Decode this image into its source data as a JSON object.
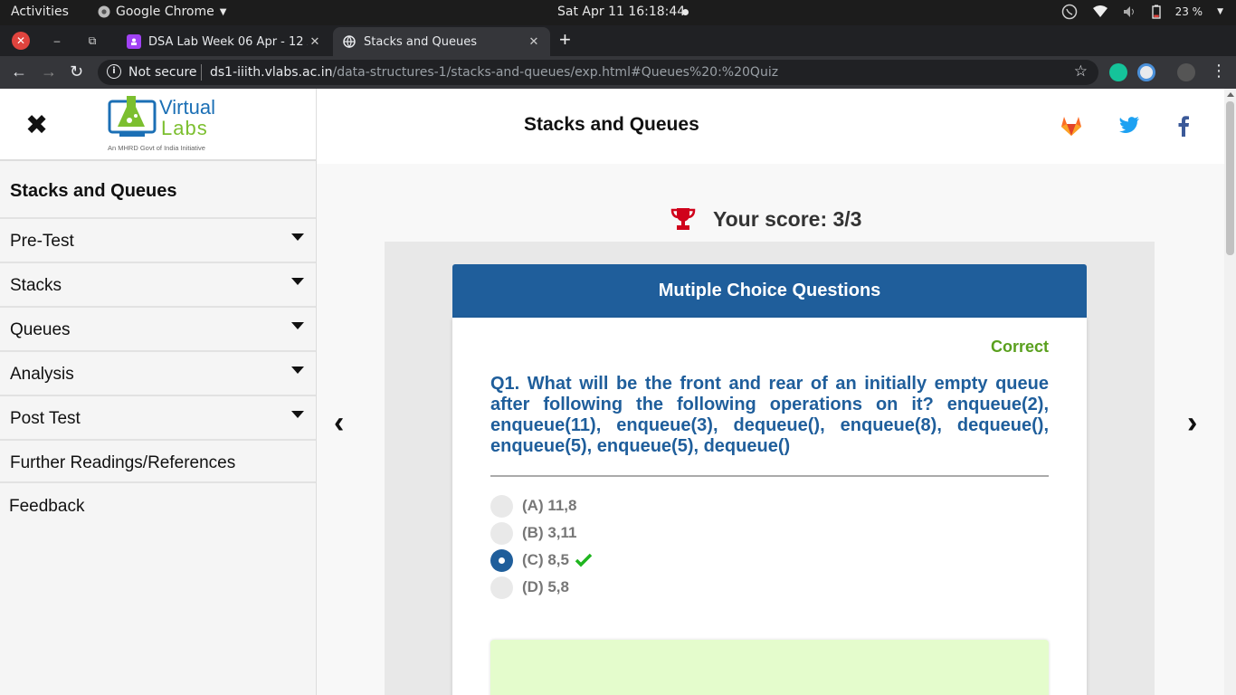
{
  "os_bar": {
    "activities": "Activities",
    "app_name": "Google Chrome",
    "clock": "Sat Apr 11  16:18:44",
    "battery": "23 %"
  },
  "browser": {
    "tabs": [
      {
        "title": "DSA Lab Week 06 Apr - 12 Apr",
        "favicon": "classroom-icon",
        "color": "#a142f4"
      },
      {
        "title": "Stacks and Queues",
        "favicon": "globe-icon",
        "active": true
      }
    ],
    "security": "Not secure",
    "url_host": "ds1-iiith.vlabs.ac.in",
    "url_path": "/data-structures-1/stacks-and-queues/exp.html#Queues%20:%20Quiz"
  },
  "logo": {
    "line1": "Virtual",
    "line2": "Labs",
    "tagline": "An MHRD Govt of India Initiative"
  },
  "sidebar": {
    "title": "Stacks and Queues",
    "items": [
      {
        "label": "Pre-Test",
        "has_caret": true
      },
      {
        "label": "Stacks",
        "has_caret": true
      },
      {
        "label": "Queues",
        "has_caret": true
      },
      {
        "label": "Analysis",
        "has_caret": true
      },
      {
        "label": "Post Test",
        "has_caret": true
      },
      {
        "label": "Further Readings/References",
        "has_caret": false
      }
    ],
    "feedback": "Feedback"
  },
  "header": {
    "title": "Stacks and Queues",
    "social": [
      "gitlab-icon",
      "twitter-icon",
      "facebook-icon"
    ]
  },
  "quiz": {
    "score": "Your score: 3/3",
    "section_title": "Mutiple Choice Questions",
    "status": "Correct",
    "question": "Q1. What will be the front and rear of an initially empty queue after following the following operations on it? enqueue(2), enqueue(11), enqueue(3), dequeue(), enqueue(8), dequeue(), enqueue(5), enqueue(5), dequeue()",
    "options": [
      {
        "label": "(A) 11,8",
        "selected": false,
        "correct": false
      },
      {
        "label": "(B) 3,11",
        "selected": false,
        "correct": false
      },
      {
        "label": "(C) 8,5",
        "selected": true,
        "correct": true
      },
      {
        "label": "(D) 5,8",
        "selected": false,
        "correct": false
      }
    ]
  },
  "colors": {
    "accent_blue": "#1f5e9b",
    "correct_green": "#5aa01e",
    "explanation_bg": "#e4fccc",
    "trophy_red": "#d0021b"
  }
}
